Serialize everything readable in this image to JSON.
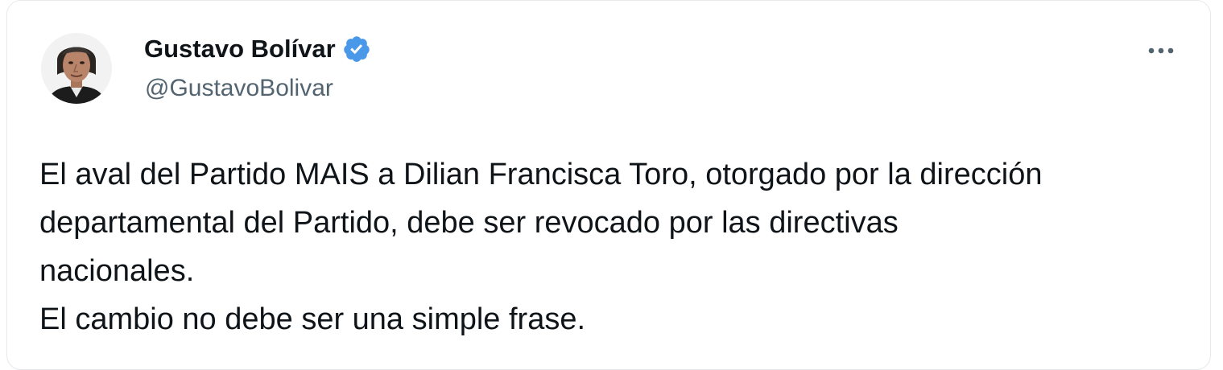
{
  "author": {
    "display_name": "Gustavo Bolívar",
    "handle": "@GustavoBolivar",
    "verified_icon": "verified-badge-icon",
    "verified_color": "#4a99e9"
  },
  "menu": {
    "icon": "more-options-icon"
  },
  "tweet": {
    "lines": [
      "El aval del Partido MAIS a Dilian Francisca Toro, otorgado por la dirección",
      "departamental del Partido, debe ser revocado por las directivas",
      "nacionales.",
      "El cambio no debe ser una simple frase."
    ]
  },
  "colors": {
    "text_primary": "#0f1419",
    "text_secondary": "#536471",
    "border": "#e6e9ea"
  }
}
